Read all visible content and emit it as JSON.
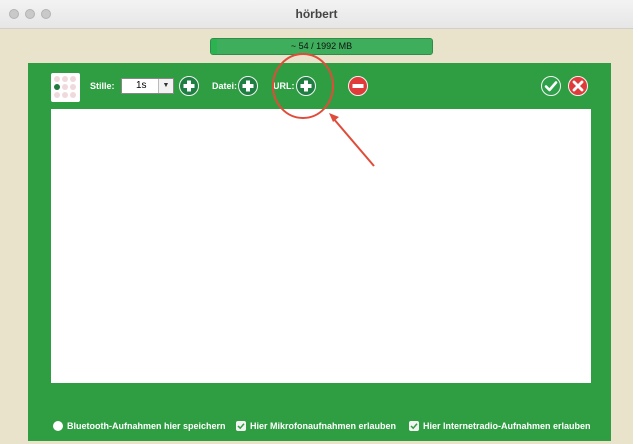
{
  "window": {
    "title": "hörbert"
  },
  "memory": {
    "text": "~ 54 / 1992 MB",
    "used_fraction": 0.027
  },
  "toolbar": {
    "silence_label": "Stille:",
    "silence_value": "1s",
    "file_label": "Datei:",
    "url_label": "URL:"
  },
  "footer": {
    "bluetooth_label": "Bluetooth-Aufnahmen hier speichern",
    "microphone_label": "Hier Mikrofonaufnahmen erlauben",
    "internetradio_label": "Hier Internetradio-Aufnahmen erlauben"
  },
  "colors": {
    "panel_green": "#2f9e42",
    "button_dark_green": "#1f7f42",
    "remove_red": "#e03a3a",
    "annotation_red": "#e04c3a",
    "background_beige": "#eae3cc"
  },
  "icons": {
    "plus": "plus-icon",
    "minus": "minus-icon",
    "confirm": "check-icon",
    "cancel": "close-icon",
    "grid": "grid-icon"
  }
}
